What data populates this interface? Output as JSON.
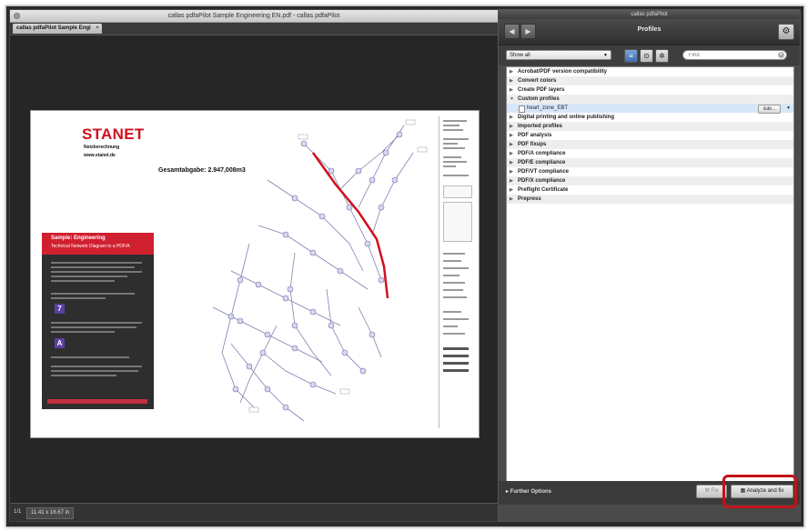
{
  "left_window": {
    "title": "callas pdfaPilot Sample Engineering EN.pdf - callas pdfaPilot",
    "tab_label": "callas pdfaPilot Sample Engi",
    "tab_close": "×",
    "status": {
      "page": "1/1",
      "size": "11.41 x 16.67 in"
    }
  },
  "pdf": {
    "logo": "STANET",
    "logo_line1": "Netzberechnung",
    "logo_line2": "www.stanet.de",
    "total": "Gesamtabgabe: 2.947,008m3",
    "info_title": "Sample: Engineering",
    "info_subtitle": "Technical Network Diagram to a PDF/A",
    "step_icons": [
      "7",
      "A"
    ]
  },
  "right_window": {
    "title": "callas pdfaPilot",
    "toolbar_title": "Profiles",
    "back_icon": "◀",
    "forward_icon": "▶",
    "gear_icon": "⚙",
    "show_select": "Show all",
    "find_placeholder": "Find",
    "profile_groups": [
      "Acrobat/PDF version compatibility",
      "Convert colors",
      "Create PDF layers",
      "Custom profiles"
    ],
    "selected_profile": "heart_zone_EBT",
    "edit_label": "Edit...",
    "profile_groups_after": [
      "Digital printing and online publishing",
      "Imported profiles",
      "PDF analysis",
      "PDF fixups",
      "PDF/A compliance",
      "PDF/E compliance",
      "PDF/VT compliance",
      "PDF/X compliance",
      "Preflight Certificate",
      "Prepress"
    ],
    "further_options": "Further Options",
    "fix_label": "Fix",
    "analyze_label": "Analyze and fix"
  },
  "colors": {
    "accent_red": "#c4121a",
    "selection_blue": "#d7e7f7",
    "logo_red": "#d0101e"
  }
}
